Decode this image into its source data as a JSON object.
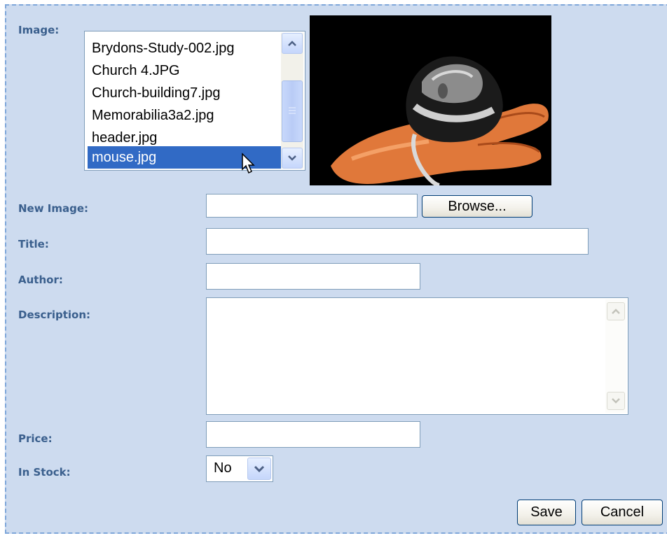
{
  "form": {
    "image_label": "Image:",
    "image_list": [
      "Brydons-Study-002.jpg",
      "Church 4.JPG",
      "Church-building7.jpg",
      "Memorabilia3a2.jpg",
      "header.jpg",
      "mouse.jpg"
    ],
    "image_selected": "mouse.jpg",
    "new_image_label": "New Image:",
    "new_image_value": "",
    "browse_label": "Browse...",
    "title_label": "Title:",
    "title_value": "",
    "author_label": "Author:",
    "author_value": "",
    "description_label": "Description:",
    "description_value": "",
    "price_label": "Price:",
    "price_value": "",
    "in_stock_label": "In Stock:",
    "in_stock_value": "No",
    "save_label": "Save",
    "cancel_label": "Cancel"
  },
  "colors": {
    "panel_bg": "#cddbef",
    "panel_border": "#7ea6d9",
    "label_color": "#3a5f8d",
    "selection": "#316ac5"
  },
  "icons": {
    "scroll_up": "chevron-up-icon",
    "scroll_down": "chevron-down-icon",
    "select_dropdown": "chevron-down-icon",
    "cursor": "mouse-pointer-icon"
  }
}
